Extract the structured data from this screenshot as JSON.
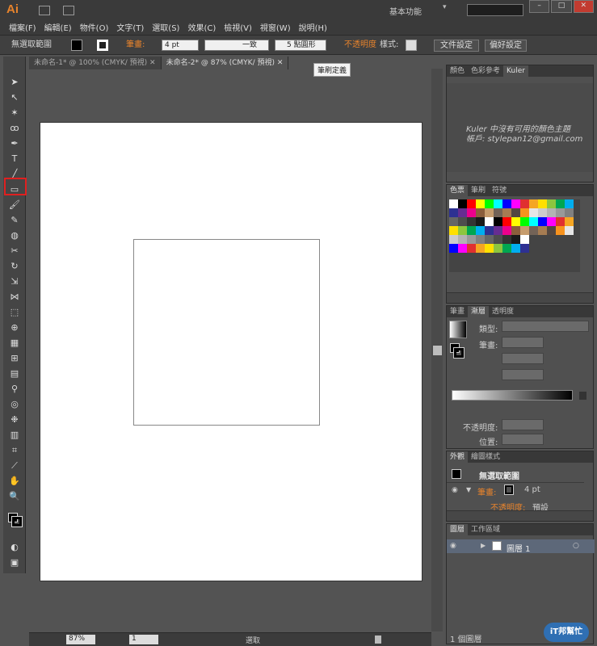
{
  "app": {
    "logo": "Ai",
    "workspace": "基本功能"
  },
  "menus": [
    "檔案(F)",
    "編輯(E)",
    "物件(O)",
    "文字(T)",
    "選取(S)",
    "效果(C)",
    "檢視(V)",
    "視窗(W)",
    "說明(H)"
  ],
  "control_bar": {
    "selection": "無選取範圍",
    "stroke_label": "筆畫:",
    "stroke_value": "4 pt",
    "stroke_style": "一致",
    "brush": "5 點圓形",
    "opacity_label": "不透明度",
    "style_label": "樣式:",
    "doc_setup": "文件設定",
    "prefs": "偏好設定"
  },
  "tabs": [
    "未命名-1* @ 100% (CMYK/ 預視)",
    "未命名-2* @ 87% (CMYK/ 預視)"
  ],
  "tooltip": "筆刷定義",
  "kuler_panel": {
    "tabs": [
      "顏色",
      "色彩參考",
      "Kuler"
    ],
    "message_line1": "Kuler 中沒有可用的顏色主題",
    "message_line2": "帳戶: stylepan12@gmail.com"
  },
  "swatches_panel": {
    "tabs": [
      "色票",
      "筆刷",
      "符號"
    ]
  },
  "gradient_panel": {
    "tabs": [
      "筆畫",
      "漸層",
      "透明度"
    ],
    "type_label": "類型:",
    "stroke_label": "筆畫:",
    "opacity_label": "不透明度:",
    "position_label": "位置:"
  },
  "appearance_panel": {
    "tabs": [
      "外觀",
      "繪圖樣式"
    ],
    "title": "無選取範圍",
    "stroke_label": "筆畫:",
    "stroke_value": "4 pt",
    "opacity_label": "不透明度:",
    "opacity_value": "預設"
  },
  "layers_panel": {
    "tabs": [
      "圖層",
      "工作區域"
    ],
    "layer_name": "圖層 1",
    "footer": "1 個圖層"
  },
  "status": {
    "zoom": "87%",
    "page": "1",
    "mode": "選取"
  },
  "watermark": "iT邦幫忙",
  "colors": {
    "accent": "#e7832c",
    "highlight": "#e02020"
  }
}
